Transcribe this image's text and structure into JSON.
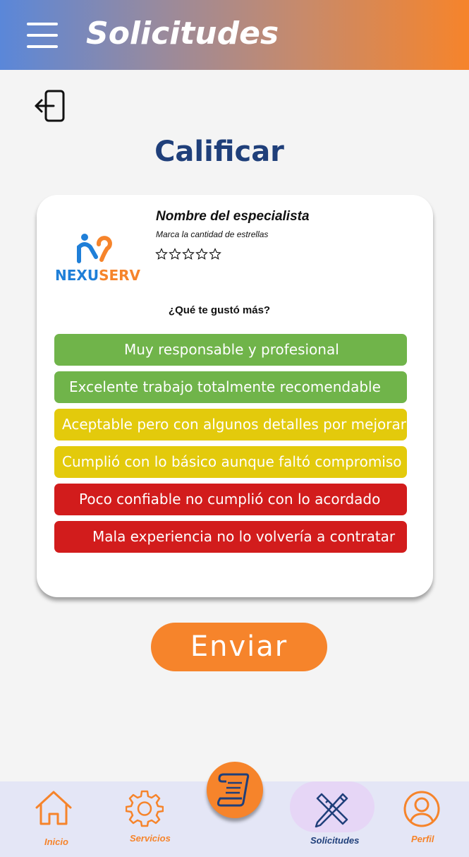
{
  "header": {
    "title": "Solicitudes",
    "menu_icon": "hamburger-menu-icon"
  },
  "back_icon": "logout-back-icon",
  "page_title": "Calificar",
  "card": {
    "logo": {
      "part1": "NEXU",
      "part2": "SERV"
    },
    "specialist_name": "Nombre del especialista",
    "stars_hint": "Marca la  cantidad de estrellas",
    "rating": {
      "value": 0,
      "max": 5
    },
    "question": "¿Qué te gustó más?",
    "options": [
      {
        "label": "Muy responsable y profesional",
        "color": "#70b44a"
      },
      {
        "label": "Excelente trabajo totalmente recomendable",
        "color": "#70b44a"
      },
      {
        "label": "Aceptable pero con algunos detalles por mejorar",
        "color": "#e3ca0c"
      },
      {
        "label": "Cumplió con lo básico aunque faltó compromiso",
        "color": "#e3ca0c"
      },
      {
        "label": "Poco confiable no cumplió con lo acordado",
        "color": "#d21c1c"
      },
      {
        "label": "Mala experiencia no lo volvería a contratar",
        "color": "#d21c1c"
      }
    ]
  },
  "send_button": "Enviar",
  "bottom_nav": {
    "items": [
      {
        "label": "Inicio",
        "icon": "home-icon"
      },
      {
        "label": "Servicios",
        "icon": "gear-icon"
      },
      {
        "label": "Solicitudes",
        "icon": "pencil-ruler-icon",
        "active": true
      },
      {
        "label": "Perfil",
        "icon": "user-icon"
      }
    ],
    "center_icon": "scroll-icon"
  },
  "colors": {
    "accent": "#f6842b",
    "title_blue": "#1f3f7a",
    "nav_active_text": "#1f3f7a"
  }
}
